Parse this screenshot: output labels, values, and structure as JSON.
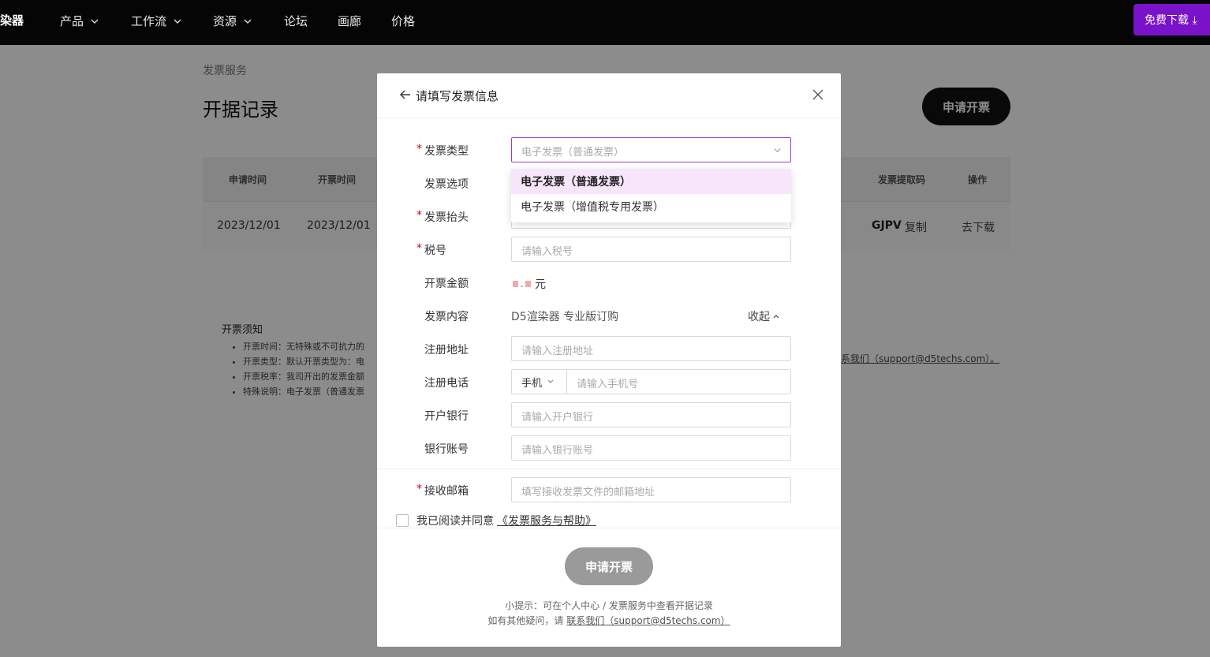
{
  "nav": {
    "brand": "染器",
    "items": [
      {
        "label": "产品",
        "has_menu": true
      },
      {
        "label": "工作流",
        "has_menu": true
      },
      {
        "label": "资源",
        "has_menu": true
      },
      {
        "label": "论坛",
        "has_menu": false
      },
      {
        "label": "画廊",
        "has_menu": false
      },
      {
        "label": "价格",
        "has_menu": false
      }
    ],
    "download": "免费下载 ⤓"
  },
  "page": {
    "breadcrumb": "发票服务",
    "title": "开据记录",
    "apply_button": "申请开票",
    "table": {
      "headers": {
        "apply_time": "申请时间",
        "issue_time": "开票时间",
        "code": "发票提取码",
        "action": "操作"
      },
      "row": {
        "apply_time": "2023/12/01",
        "issue_time": "2023/12/01",
        "code": "GJPV",
        "copy": "复制",
        "download": "去下载"
      }
    },
    "notes": {
      "title": "开票须知",
      "items": [
        "开票时间：无特殊或不可抗力的",
        "开票类型：默认开票类型为：电",
        "开票税率：我司开出的发票金额",
        "特殊说明：电子发票（普通发票"
      ],
      "contact": "系我们（support@d5techs.com）。"
    }
  },
  "modal": {
    "title": "请填写发票信息",
    "fields": {
      "invoice_type": {
        "label": "发票类型",
        "placeholder": "电子发票（普通发票）"
      },
      "invoice_option": {
        "label": "发票选项"
      },
      "invoice_header": {
        "label": "发票抬头"
      },
      "tax_id": {
        "label": "税号",
        "placeholder": "请输入税号"
      },
      "amount": {
        "label": "开票金额",
        "unit": "元"
      },
      "content": {
        "label": "发票内容",
        "value": "D5渲染器 专业版订购",
        "collapse": "收起"
      },
      "reg_address": {
        "label": "注册地址",
        "placeholder": "请输入注册地址"
      },
      "reg_phone": {
        "label": "注册电话",
        "type": "手机",
        "placeholder": "请输入手机号"
      },
      "bank": {
        "label": "开户银行",
        "placeholder": "请输入开户银行"
      },
      "bank_account": {
        "label": "银行账号",
        "placeholder": "请输入银行账号"
      },
      "email": {
        "label": "接收邮箱",
        "placeholder": "填写接收发票文件的邮箱地址"
      }
    },
    "dropdown": {
      "options": [
        "电子发票（普通发票）",
        "电子发票（增值税专用发票）"
      ],
      "selected_index": 0
    },
    "agree": {
      "text": "我已阅读并同意",
      "link": "《发票服务与帮助》"
    },
    "submit": "申请开票",
    "tip1": "小提示：可在个人中心 / 发票服务中查看开据记录",
    "tip2_prefix": "如有其他疑问，请",
    "tip2_link": "联系我们（support@d5techs.com）"
  },
  "colors": {
    "accent": "#7a12c9",
    "focus": "#a23ad6",
    "selected_bg": "#f7e6fb",
    "required": "#d0021b"
  }
}
